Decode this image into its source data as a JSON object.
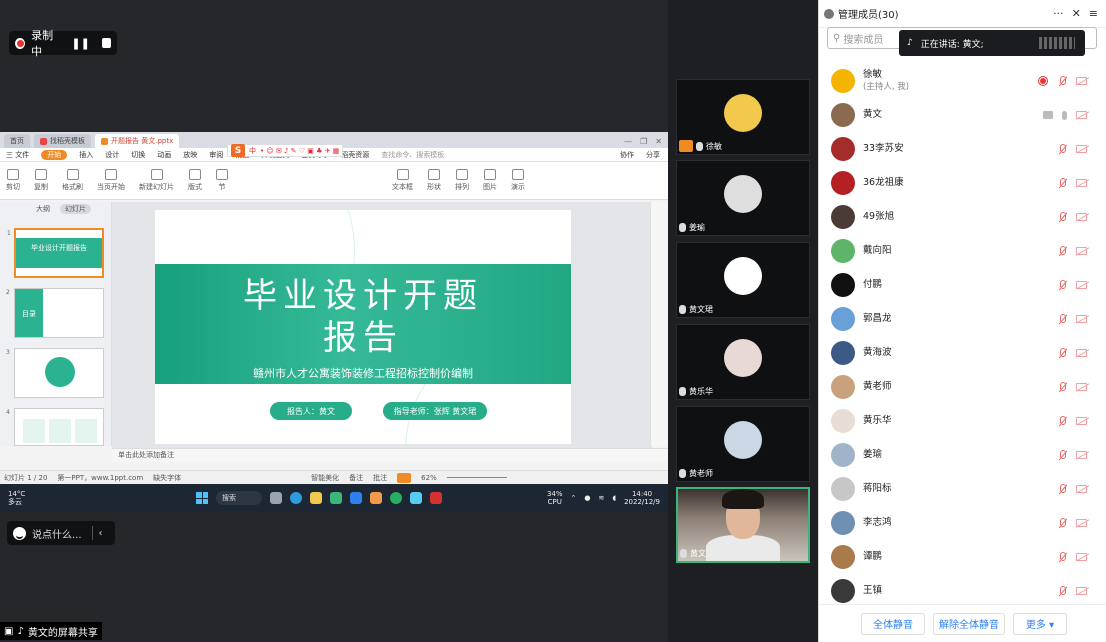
{
  "recording": {
    "label": "录制中"
  },
  "wps": {
    "tabs": [
      "首页",
      "找稻壳模板",
      "开题报告 黄文.pptx"
    ],
    "menu": [
      "三 文件",
      "开始",
      "插入",
      "设计",
      "切换",
      "动画",
      "放映",
      "审阅",
      "视图",
      "开发工具",
      "会员专享",
      "稻壳资源"
    ],
    "menu_search": "查找命令、搜索模板",
    "menu_right": [
      "协作",
      "分享"
    ],
    "ribbon": [
      "剪切",
      "复制",
      "格式刷",
      "当页开始",
      "新建幻灯片",
      "版式",
      "节",
      "文本框",
      "形状",
      "排列",
      "图片",
      "演示"
    ],
    "thumb_tabs": [
      "大纲",
      "幻灯片"
    ],
    "thumbs": [
      {
        "num": "1",
        "title": "毕业设计开题报告"
      },
      {
        "num": "2",
        "title": "目录"
      },
      {
        "num": "3",
        "title": ""
      },
      {
        "num": "4",
        "title": ""
      }
    ],
    "slide": {
      "title_line1": "毕业设计开题",
      "title_line2": "报告",
      "subtitle": "赣州市人才公寓装饰装修工程招标控制价编制",
      "reporter": "报告人：黄文",
      "advisor": "指导老师：张辉 黄文珺"
    },
    "notes_placeholder": "单击此处添加备注",
    "status": {
      "slide_count": "幻灯片 1 / 20",
      "theme": "第一PPT，www.1ppt.com",
      "missing_font": "缺失字体",
      "beautify": "智能美化",
      "notes": "备注",
      "comment": "批注",
      "zoom": "62%"
    }
  },
  "ime": {
    "logo": "S",
    "text": "中"
  },
  "taskbar": {
    "weather_temp": "14°C",
    "weather_desc": "多云",
    "search": "搜索",
    "cpu_pct": "34%",
    "cpu_label": "CPU",
    "time": "14:40",
    "date": "2022/12/9"
  },
  "chat": {
    "placeholder": "说点什么..."
  },
  "share_label": "黄文的屏幕共享",
  "videos": [
    {
      "name": "徐敏",
      "color": "#f2c94c",
      "host": true
    },
    {
      "name": "姜瑜",
      "color": "#dedede",
      "host": false
    },
    {
      "name": "黄文珺",
      "color": "#ffffff",
      "host": false
    },
    {
      "name": "黄乐华",
      "color": "#e8d9d6",
      "host": false
    },
    {
      "name": "黄老师",
      "color": "#cbd7e4",
      "host": false
    },
    {
      "name": "黄文",
      "color": "#c9c4bd",
      "host": false
    }
  ],
  "panel": {
    "title": "管理成员(30)",
    "search_placeholder": "搜索成员",
    "speaking_prefix": "正在讲话: 黄文;",
    "members": [
      {
        "name": "徐敏",
        "role": "(主持人, 我)",
        "color": "#f4b400"
      },
      {
        "name": "黄文",
        "role": "",
        "color": "#8b6b4f"
      },
      {
        "name": "33李苏安",
        "role": "",
        "color": "#a62b2b"
      },
      {
        "name": "36龙祖康",
        "role": "",
        "color": "#b52025"
      },
      {
        "name": "49张旭",
        "role": "",
        "color": "#4a3b36"
      },
      {
        "name": "戴向阳",
        "role": "",
        "color": "#5fb46b"
      },
      {
        "name": "付鹏",
        "role": "",
        "color": "#111111"
      },
      {
        "name": "郭昌龙",
        "role": "",
        "color": "#6aa0d8"
      },
      {
        "name": "黄海波",
        "role": "",
        "color": "#3b5b86"
      },
      {
        "name": "黄老师",
        "role": "",
        "color": "#c9a27d"
      },
      {
        "name": "黄乐华",
        "role": "",
        "color": "#e7ddd5"
      },
      {
        "name": "姜瑜",
        "role": "",
        "color": "#9fb4c8"
      },
      {
        "name": "蒋阳标",
        "role": "",
        "color": "#c7c7c7"
      },
      {
        "name": "李志鸿",
        "role": "",
        "color": "#6f8fb3"
      },
      {
        "name": "谭鹏",
        "role": "",
        "color": "#a97a4c"
      },
      {
        "name": "王镇",
        "role": "",
        "color": "#3a3a3a"
      }
    ],
    "buttons": [
      "全体静音",
      "解除全体静音",
      "更多 ▾"
    ]
  }
}
